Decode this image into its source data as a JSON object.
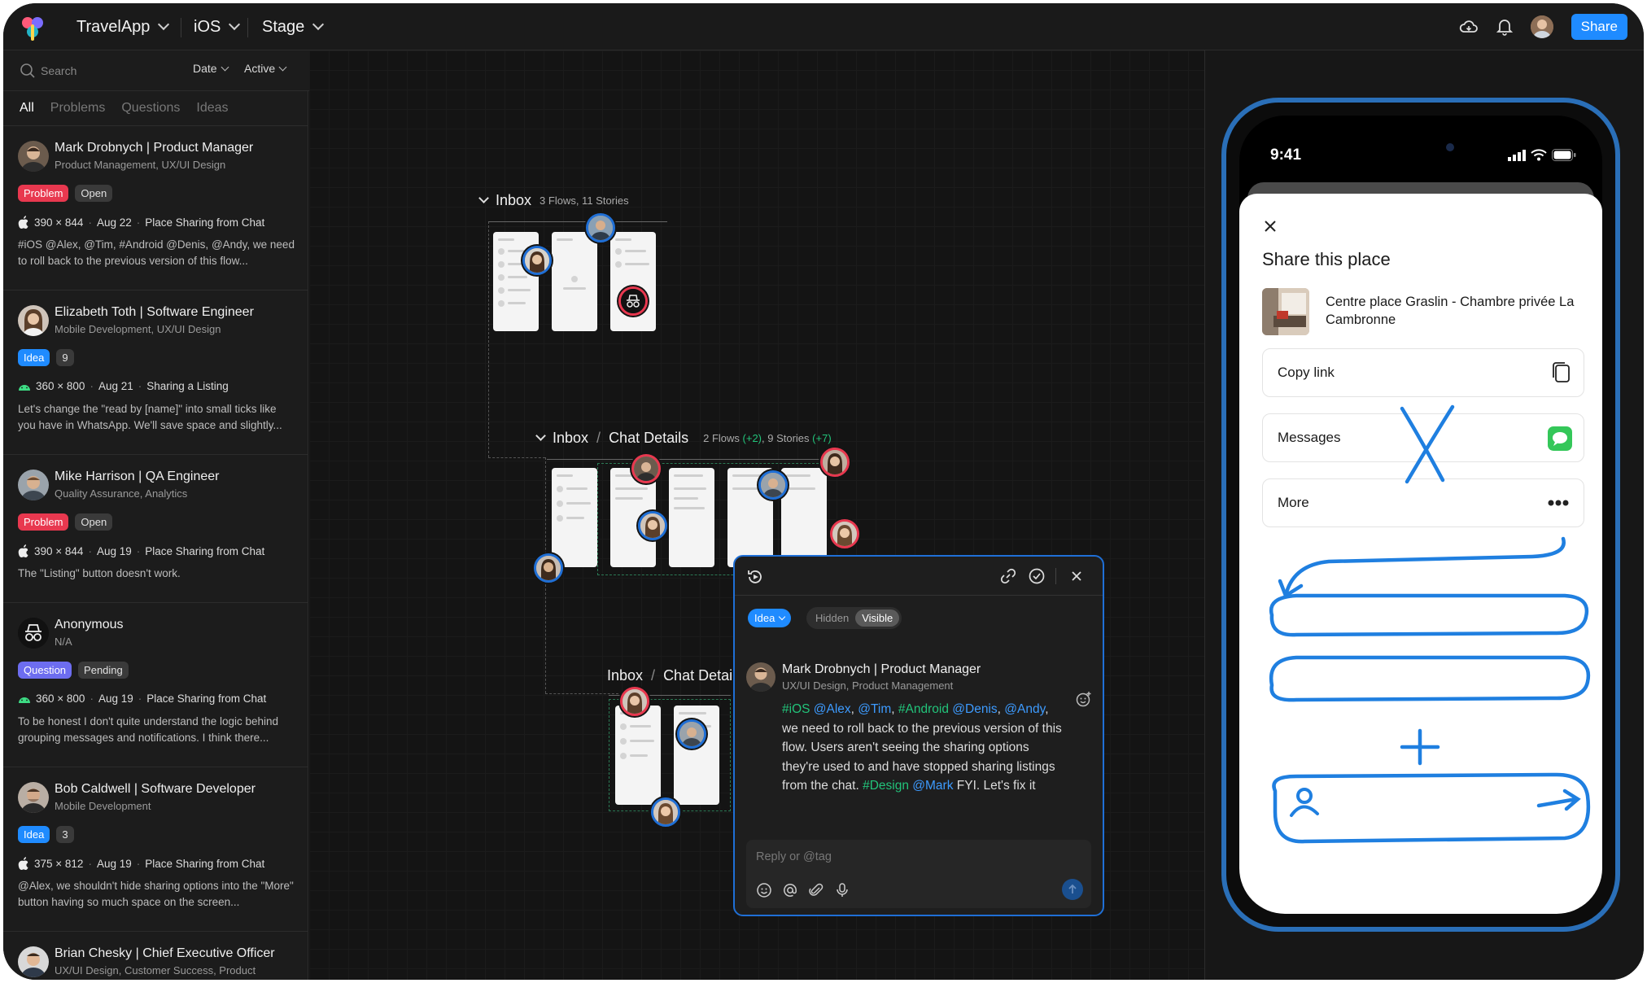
{
  "header": {
    "project": "TravelApp",
    "platform": "iOS",
    "environment": "Stage",
    "share_label": "Share"
  },
  "sidebar": {
    "search_placeholder": "Search",
    "date_filter": "Date",
    "status_filter": "Active",
    "tabs": [
      "All",
      "Problems",
      "Questions",
      "Ideas"
    ],
    "cards": [
      {
        "name": "Mark Drobnych | Product Manager",
        "role": "Product Management, UX/UI Design",
        "type": "Problem",
        "status": "Open",
        "os": "apple",
        "size": "390 × 844",
        "date": "Aug 22",
        "flow": "Place Sharing from Chat",
        "desc": "#iOS @Alex, @Tim, #Android @Denis, @Andy, we need to roll back to the previous version of this flow..."
      },
      {
        "name": "Elizabeth Toth | Software Engineer",
        "role": "Mobile Development, UX/UI Design",
        "type": "Idea",
        "status": "9",
        "os": "android",
        "size": "360 × 800",
        "date": "Aug 21",
        "flow": "Sharing a Listing",
        "desc": "Let's change the \"read by [name]\" into small ticks like you have in WhatsApp. We'll save space and slightly..."
      },
      {
        "name": "Mike Harrison | QA Engineer",
        "role": "Quality Assurance, Analytics",
        "type": "Problem",
        "status": "Open",
        "os": "apple",
        "size": "390 × 844",
        "date": "Aug 19",
        "flow": "Place Sharing from Chat",
        "desc": "The \"Listing\" button doesn't work."
      },
      {
        "name": "Anonymous",
        "role": "N/A",
        "type": "Question",
        "status": "Pending",
        "os": "android",
        "size": "360 × 800",
        "date": "Aug 19",
        "flow": "Place Sharing from Chat",
        "desc": "To be honest I don't quite understand the logic behind grouping messages and notifications. I think there..."
      },
      {
        "name": "Bob Caldwell | Software Developer",
        "role": "Mobile Development",
        "type": "Idea",
        "status": "3",
        "os": "apple",
        "size": "375 × 812",
        "date": "Aug 19",
        "flow": "Place Sharing from Chat",
        "desc": "@Alex, we shouldn't hide sharing options into the \"More\" button having so much space on the screen..."
      },
      {
        "name": "Brian Chesky | Chief Executive Officer",
        "role": "UX/UI Design, Customer Success, Product",
        "type": "",
        "status": "",
        "os": "",
        "size": "",
        "date": "",
        "flow": "",
        "desc": ""
      }
    ]
  },
  "canvas": {
    "group1": {
      "title": "Inbox",
      "sub": "3 Flows, 11 Stories"
    },
    "group2": {
      "title_a": "Inbox",
      "slash": "/",
      "title_b": "Chat Details",
      "sub_a": "2 Flows",
      "sub_a_delta": "(+2)",
      "sub_b": ", 9 Stories",
      "sub_b_delta": "(+7)"
    },
    "group3": {
      "title_a": "Inbox",
      "slash": "/",
      "title_b": "Chat Detai"
    }
  },
  "comment": {
    "type_label": "Idea",
    "visibility_hidden": "Hidden",
    "visibility_visible": "Visible",
    "author": "Mark Drobnych | Product Manager",
    "author_role": "UX/UI Design, Product Management",
    "body": {
      "t1": "#iOS",
      "m1": "@Alex",
      "s1": ", ",
      "m2": "@Tim",
      "s2": ", ",
      "t2": "#Android",
      "s3": " ",
      "m3": "@Denis",
      "s4": ", ",
      "m4": "@Andy",
      "s5": ", we need to roll back to the previous version of this flow. Users aren't seeing the sharing options they're used to and have stopped sharing listings from the chat. ",
      "t3": "#Design",
      "s6": " ",
      "m5": "@Mark",
      "s7": " FYI. Let's fix it"
    },
    "reply_placeholder": "Reply or @tag"
  },
  "phone": {
    "time": "9:41",
    "sheet_title": "Share this place",
    "place_name": "Centre place Graslin - Chambre privée La Cambronne",
    "options": [
      "Copy link",
      "Messages",
      "More"
    ]
  },
  "colors": {
    "accent": "#1f8bff",
    "problem": "#e8384f",
    "question": "#6d6df0",
    "tag_green": "#22c37a",
    "sketch_blue": "#1f7fe0"
  }
}
